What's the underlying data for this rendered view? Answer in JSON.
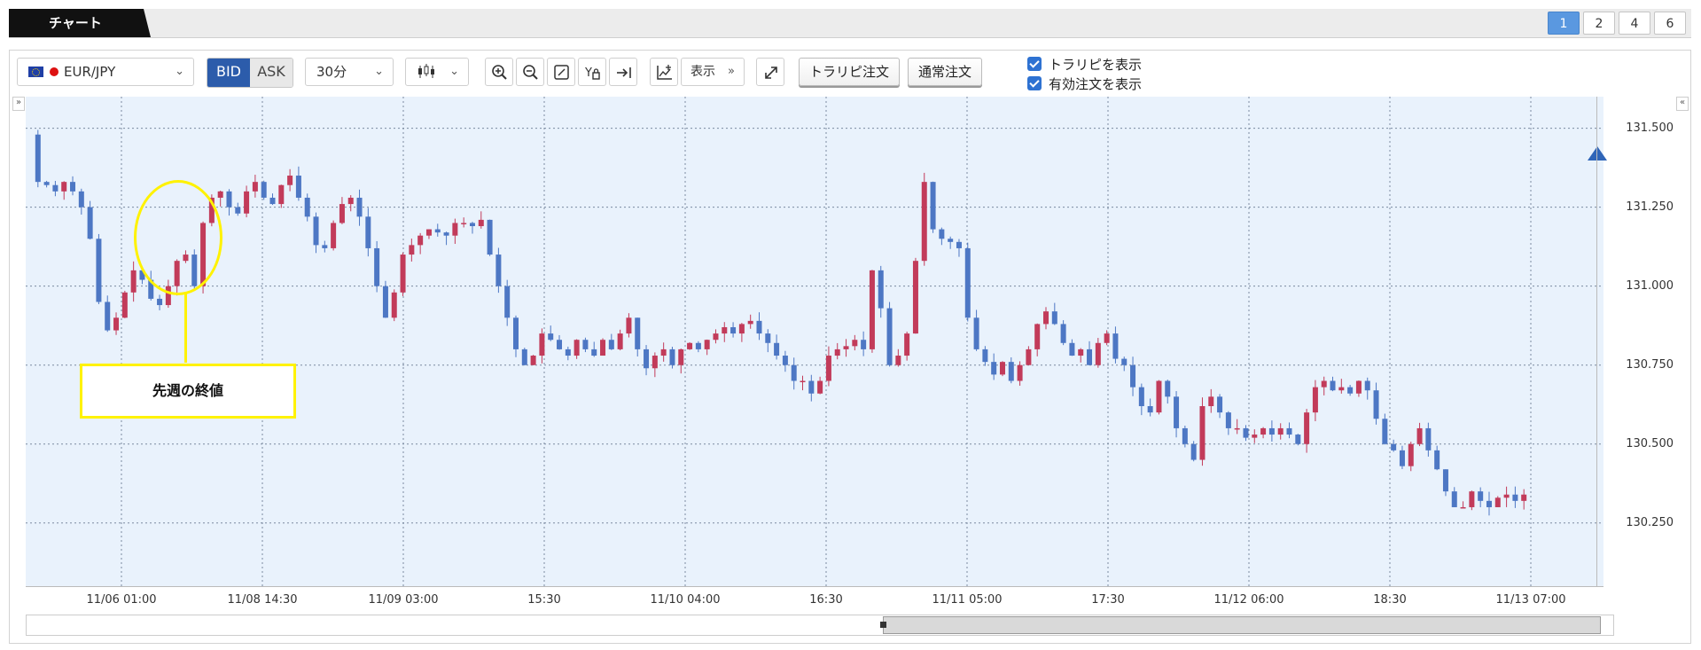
{
  "header": {
    "tab_label": "チャート",
    "layouts": [
      "1",
      "2",
      "4",
      "6"
    ],
    "active_layout": "1"
  },
  "toolbar": {
    "pair": "EUR/JPY",
    "bid_label": "BID",
    "ask_label": "ASK",
    "period": "30分",
    "show_label": "表示",
    "tralipi_order": "トラリピ注文",
    "normal_order": "通常注文",
    "checkboxes": [
      {
        "label": "トラリピを表示",
        "checked": true
      },
      {
        "label": "有効注文を表示",
        "checked": true
      }
    ]
  },
  "annotation": {
    "label": "先週の終値"
  },
  "chart_data": {
    "type": "candlestick",
    "price_ticks": [
      "131.500",
      "131.250",
      "131.000",
      "130.750",
      "130.500",
      "130.250"
    ],
    "time_ticks": [
      "11/06 01:00",
      "11/08 14:30",
      "11/09 03:00",
      "15:30",
      "11/10 04:00",
      "16:30",
      "11/11 05:00",
      "17:30",
      "11/12 06:00",
      "18:30",
      "11/13 07:00"
    ],
    "ylim": [
      130.05,
      131.6
    ],
    "grid": true,
    "colors": {
      "up": "#c23b5a",
      "down": "#4d77c4",
      "background": "#e9f2fc"
    },
    "close_path": [
      131.48,
      131.33,
      131.32,
      131.3,
      131.33,
      131.3,
      131.25,
      131.15,
      130.95,
      130.86,
      130.9,
      130.98,
      131.05,
      131.02,
      130.96,
      130.94,
      131.0,
      131.08,
      131.1,
      131.0,
      131.2,
      131.28,
      131.3,
      131.25,
      131.23,
      131.3,
      131.33,
      131.28,
      131.26,
      131.32,
      131.35,
      131.28,
      131.22,
      131.13,
      131.12,
      131.2,
      131.26,
      131.28,
      131.22,
      131.12,
      131.0,
      130.9,
      130.98,
      131.1,
      131.13,
      131.16,
      131.18,
      131.17,
      131.16,
      131.2,
      131.2,
      131.19,
      131.21,
      131.1,
      131.0,
      130.9,
      130.8,
      130.75,
      130.78,
      130.85,
      130.83,
      130.8,
      130.78,
      130.83,
      130.8,
      130.78,
      130.83,
      130.8,
      130.85,
      130.9,
      130.8,
      130.74,
      130.78,
      130.8,
      130.75,
      130.8,
      130.82,
      130.8,
      130.83,
      130.85,
      130.87,
      130.85,
      130.88,
      130.89,
      130.85,
      130.82,
      130.78,
      130.75,
      130.7,
      130.7,
      130.66,
      130.7,
      130.78,
      130.8,
      130.81,
      130.83,
      130.8,
      131.05,
      130.93,
      130.75,
      130.78,
      130.85,
      131.08,
      131.33,
      131.18,
      131.15,
      131.14,
      131.12,
      130.9,
      130.8,
      130.76,
      130.72,
      130.76,
      130.7,
      130.75,
      130.8,
      130.88,
      130.92,
      130.88,
      130.82,
      130.78,
      130.8,
      130.75,
      130.82,
      130.85,
      130.77,
      130.75,
      130.68,
      130.62,
      130.6,
      130.7,
      130.65,
      130.55,
      130.5,
      130.45,
      130.62,
      130.65,
      130.6,
      130.55,
      130.55,
      130.52,
      130.53,
      130.55,
      130.53,
      130.55,
      130.53,
      130.5,
      130.6,
      130.68,
      130.7,
      130.67,
      130.68,
      130.66,
      130.7,
      130.67,
      130.58,
      130.5,
      130.48,
      130.43,
      130.5,
      130.55,
      130.48,
      130.42,
      130.35,
      130.3,
      130.3,
      130.35,
      130.32,
      130.3,
      130.33,
      130.34,
      130.32,
      130.34
    ]
  }
}
